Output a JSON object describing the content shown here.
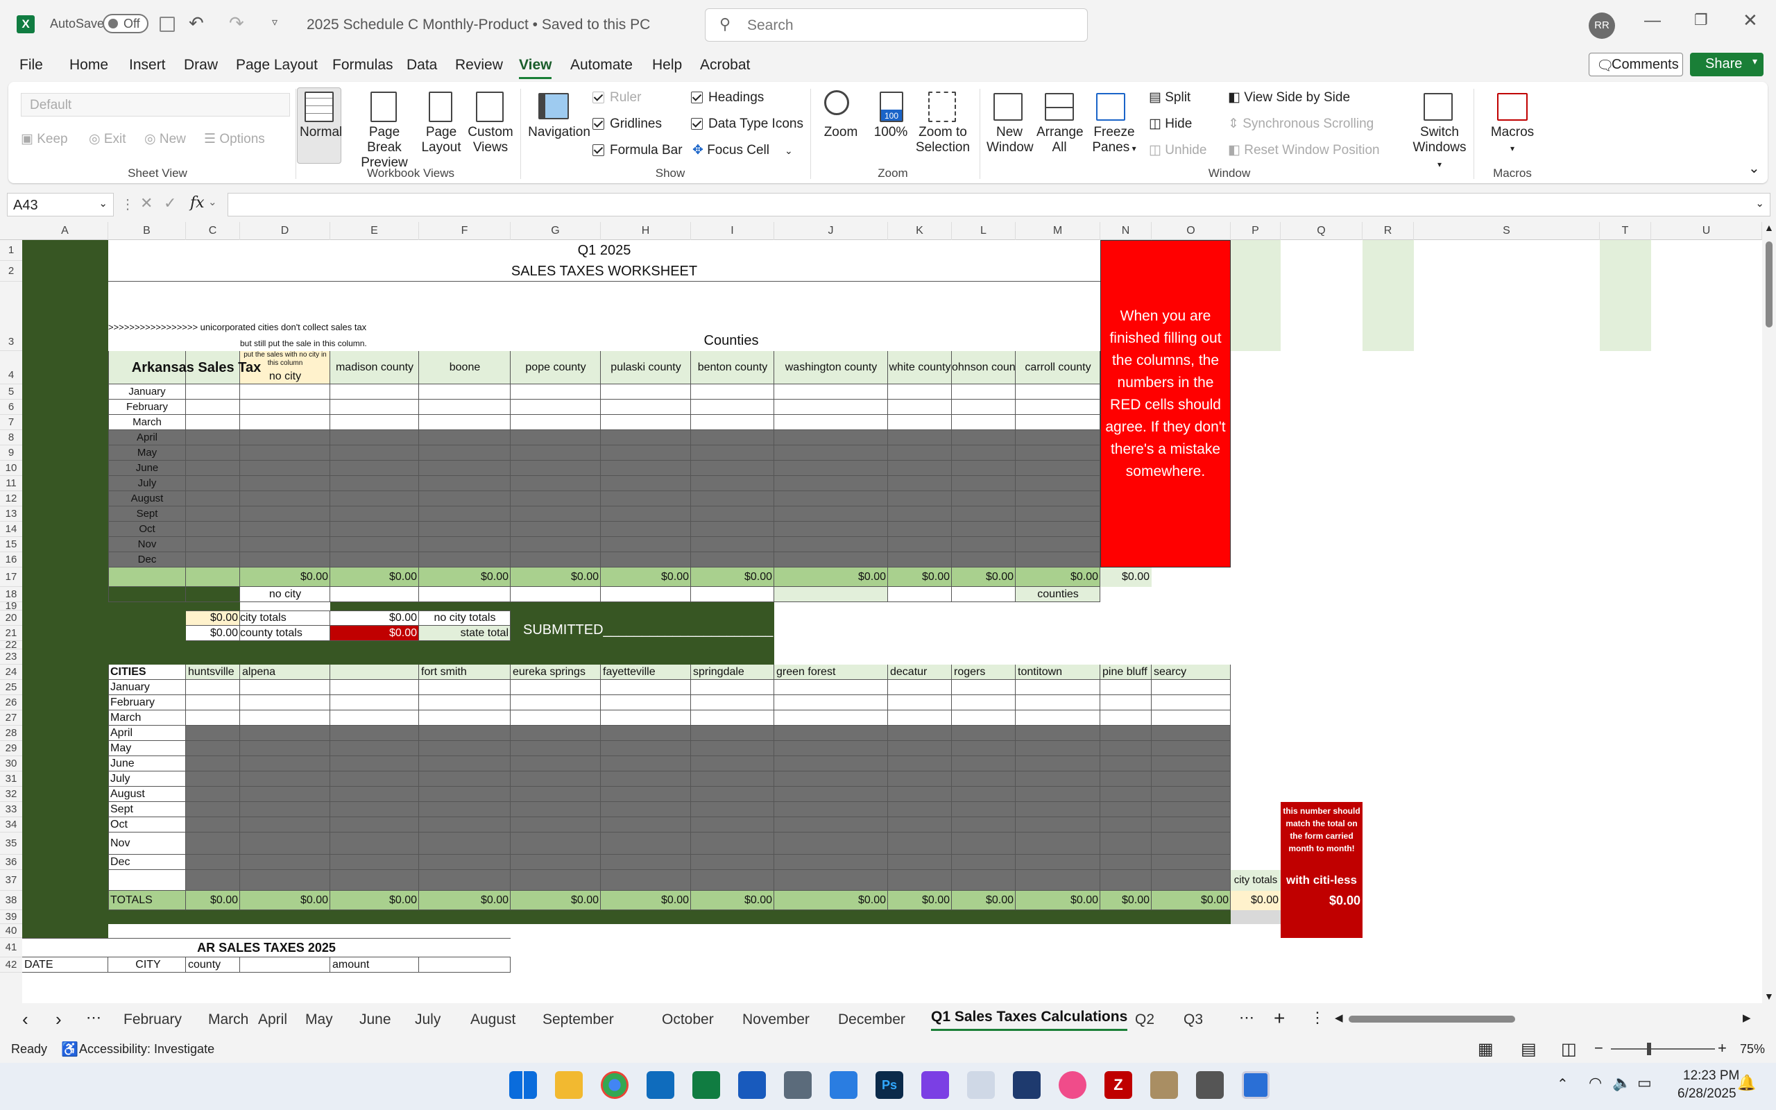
{
  "titlebar": {
    "autosave": "AutoSave",
    "autosave_state": "Off",
    "doc_title": "2025 Schedule C Monthly-Product • Saved to this PC",
    "search_placeholder": "Search",
    "avatar": "RR"
  },
  "menu": {
    "tabs": [
      "File",
      "Home",
      "Insert",
      "Draw",
      "Page Layout",
      "Formulas",
      "Data",
      "Review",
      "View",
      "Automate",
      "Help",
      "Acrobat"
    ],
    "active": "View",
    "comments": "Comments",
    "share": "Share"
  },
  "ribbon": {
    "sheet_view": {
      "dropdown": "Default",
      "keep": "Keep",
      "exit": "Exit",
      "new": "New",
      "options": "Options",
      "group": "Sheet View"
    },
    "workbook_views": {
      "normal": "Normal",
      "page_break": "Page Break Preview",
      "page_layout": "Page Layout",
      "custom_views": "Custom Views",
      "group": "Workbook Views"
    },
    "show": {
      "navigation": "Navigation",
      "ruler": "Ruler",
      "gridlines": "Gridlines",
      "formula_bar": "Formula Bar",
      "headings": "Headings",
      "data_type_icons": "Data Type Icons",
      "focus_cell": "Focus Cell",
      "group": "Show"
    },
    "zoom": {
      "zoom": "Zoom",
      "hundred": "100%",
      "to_selection": "Zoom to Selection",
      "group": "Zoom"
    },
    "window": {
      "new_window": "New Window",
      "arrange_all": "Arrange All",
      "freeze_panes": "Freeze Panes",
      "split": "Split",
      "hide": "Hide",
      "unhide": "Unhide",
      "side_by_side": "View Side by Side",
      "sync_scroll": "Synchronous Scrolling",
      "reset_pos": "Reset Window Position",
      "switch_windows": "Switch Windows",
      "group": "Window"
    },
    "macros": {
      "macros": "Macros",
      "group": "Macros"
    }
  },
  "formula_bar": {
    "name_box": "A43",
    "fx": "fx",
    "value": ""
  },
  "columns": [
    "A",
    "B",
    "C",
    "D",
    "E",
    "F",
    "G",
    "H",
    "I",
    "J",
    "K",
    "L",
    "M",
    "N",
    "O",
    "P",
    "Q",
    "R",
    "S",
    "T",
    "U"
  ],
  "sheet": {
    "title1": "Q1 2025",
    "title2": "SALES TAXES WORKSHEET",
    "note1": ">>>>>>>>>>>>>>>>> unicorporated cities don't collect sales tax",
    "note2": "but still put the sale in this column.",
    "counties_header": "Counties",
    "ar_sales_tax": "Arkansas Sales Tax",
    "no_city_note": "put the sales with no city in this column",
    "county_cols": [
      "no city",
      "madison county",
      "boone",
      "pope county",
      "pulaski county",
      "benton county",
      "washington county",
      "white county",
      "ohnson count",
      "carroll  county"
    ],
    "months": [
      "January",
      "February",
      "March",
      "April",
      "May",
      "June",
      "July",
      "August",
      "Sept",
      "Oct",
      "Nov",
      "Dec"
    ],
    "row17": [
      "$0.00",
      "$0.00",
      "$0.00",
      "$0.00",
      "$0.00",
      "$0.00",
      "$0.00",
      "$0.00",
      "$0.00",
      "$0.00",
      "$0.00"
    ],
    "row18_nocity": "no city",
    "row18_counties": "counties",
    "red_note": "When you are finished filling out the columns, the numbers in the RED cells should agree. If they don't there's a mistake somewhere.",
    "totals_block": {
      "c20": "$0.00",
      "d20": "city totals",
      "c21": "$0.00",
      "d21": "county totals",
      "e20": "$0.00",
      "f20": "no city totals",
      "e21": "$0.00",
      "f21": "state total"
    },
    "submitted": "SUBMITTED______________________",
    "cities_label": "CITIES",
    "city_cols": [
      "huntsville",
      "alpena",
      "",
      "fort smith",
      "eureka springs",
      "fayetteville",
      "springdale",
      "green forest",
      "decatur",
      "rogers",
      "tontitown",
      "pine bluff",
      "searcy"
    ],
    "months2": [
      "January",
      "February",
      "March",
      "April",
      "May",
      "June",
      "July",
      "August",
      "Sept",
      "Oct",
      "Nov",
      "Dec",
      ""
    ],
    "totals_label": "TOTALS",
    "row38": [
      "$0.00",
      "$0.00",
      "$0.00",
      "$0.00",
      "$0.00",
      "$0.00",
      "$0.00",
      "$0.00",
      "$0.00",
      "$0.00",
      "$0.00",
      "$0.00",
      "$0.00",
      "$0.00"
    ],
    "city_totals_label": "city totals",
    "citiless_label": "with citi-less",
    "citiless_value": "$0.00",
    "match_note": "this number should match the total on the form carried month to month!",
    "ar_2025": "AR SALES TAXES 2025",
    "row42": [
      "DATE",
      "CITY",
      "county",
      "amount"
    ]
  },
  "sheet_tabs": [
    "February",
    "March",
    "April",
    "May",
    "June",
    "July",
    "August",
    "September",
    "October",
    "November",
    "December",
    "Q1 Sales Taxes Calculations",
    "Q2",
    "Q3"
  ],
  "active_tab": "Q1 Sales Taxes Calculations",
  "status": {
    "ready": "Ready",
    "accessibility": "Accessibility: Investigate",
    "zoom": "75%"
  },
  "clock": {
    "time": "12:23 PM",
    "date": "6/28/2025"
  }
}
